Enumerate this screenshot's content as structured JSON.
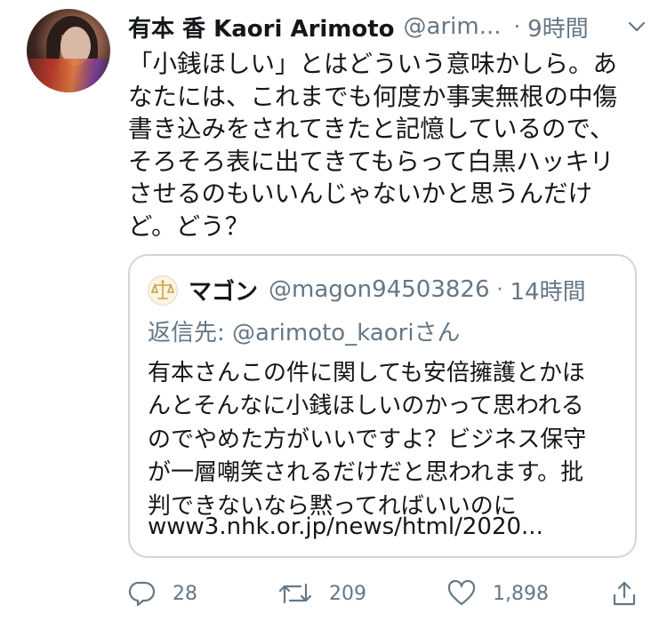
{
  "tweet": {
    "author_name": "有本 香 Kaori Arimoto",
    "handle": "@arim...",
    "separator": "·",
    "time": "9時間",
    "text": "「小銭ほしい」とはどういう意味かしら。あ\nなたには、これまでも何度か事実無根の中傷\n書き込みをされてきたと記憶しているので、\nそろそろ表に出てきてもらって白黒ハッキリ\nさせるのもいいんじゃないかと思うんだけ\nど。どう？",
    "icons": {
      "avatar": "profile-photo",
      "menu": "chevron-down-icon"
    }
  },
  "quoted": {
    "author_name": "マゴン",
    "handle": "@magon94503826",
    "separator": "·",
    "time": "14時間",
    "reply_to": "返信先: @arimoto_kaoriさん",
    "text": "有本さんこの件に関しても安倍擁護とかほ\nんとそんなに小銭ほしいのかって思われる\nのでやめた方がいいですよ？ビジネス保守\nが一層嘲笑されるだけだと思われます。批\n判できないなら黙ってればいいのに",
    "link": "www3.nhk.or.jp/news/html/2020...",
    "avatar_icon": "scales-of-justice-icon"
  },
  "actions": {
    "replies": "28",
    "retweets": "209",
    "likes": "1,898",
    "icons": [
      "reply-icon",
      "retweet-icon",
      "like-icon",
      "share-icon"
    ]
  },
  "colors": {
    "text": "#14171a",
    "secondary": "#657786",
    "border": "#ccd6dd"
  }
}
